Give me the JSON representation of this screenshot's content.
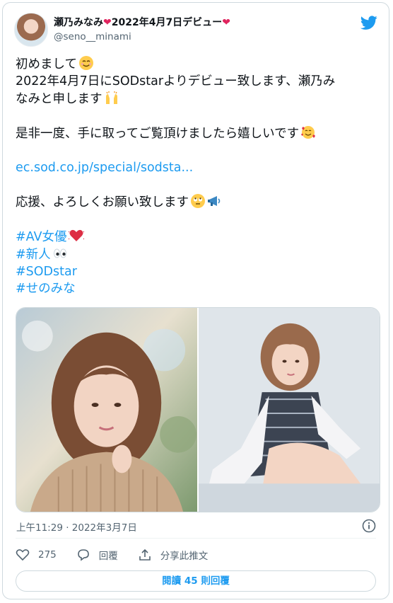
{
  "tweet": {
    "display_name": "瀬乃みなみ",
    "display_name_suffix": "2022年4月7日デビュー",
    "handle": "@seno__minami",
    "lines": {
      "l1": "初めまして",
      "l2": "2022年4月7日にSODstarよりデビュー致します、瀬乃み",
      "l3": "なみと申します",
      "l4": "是非一度、手に取ってご覧頂けましたら嬉しいです",
      "link": "ec.sod.co.jp/special/sodsta...",
      "l5": "応援、よろしくお願い致します"
    },
    "hashtags": [
      "#AV女優",
      "#新人",
      "#SODstar",
      "#せのみな"
    ],
    "timestamp": "上午11:29 · 2022年3月7日",
    "icons": {
      "brand": "twitter-bird-icon",
      "emoji_smile": "smiling-face-icon",
      "emoji_hands": "raising-hands-icon",
      "emoji_hearts": "smiling-face-with-hearts-icon",
      "emoji_eyeroll": "face-with-rolling-eyes-icon",
      "emoji_megaphone": "megaphone-icon",
      "emoji_heart": "beating-heart-icon",
      "emoji_eyes": "eyes-icon"
    }
  },
  "actions": {
    "like_count": "275",
    "reply_label": "回覆",
    "share_label": "分享此推文"
  },
  "replies_button": "閱讀 45 則回覆",
  "colors": {
    "accent": "#1d9bf0",
    "heart": "#e0245e",
    "text": "#0f1419",
    "muted": "#536471",
    "border": "#cfd9de"
  }
}
